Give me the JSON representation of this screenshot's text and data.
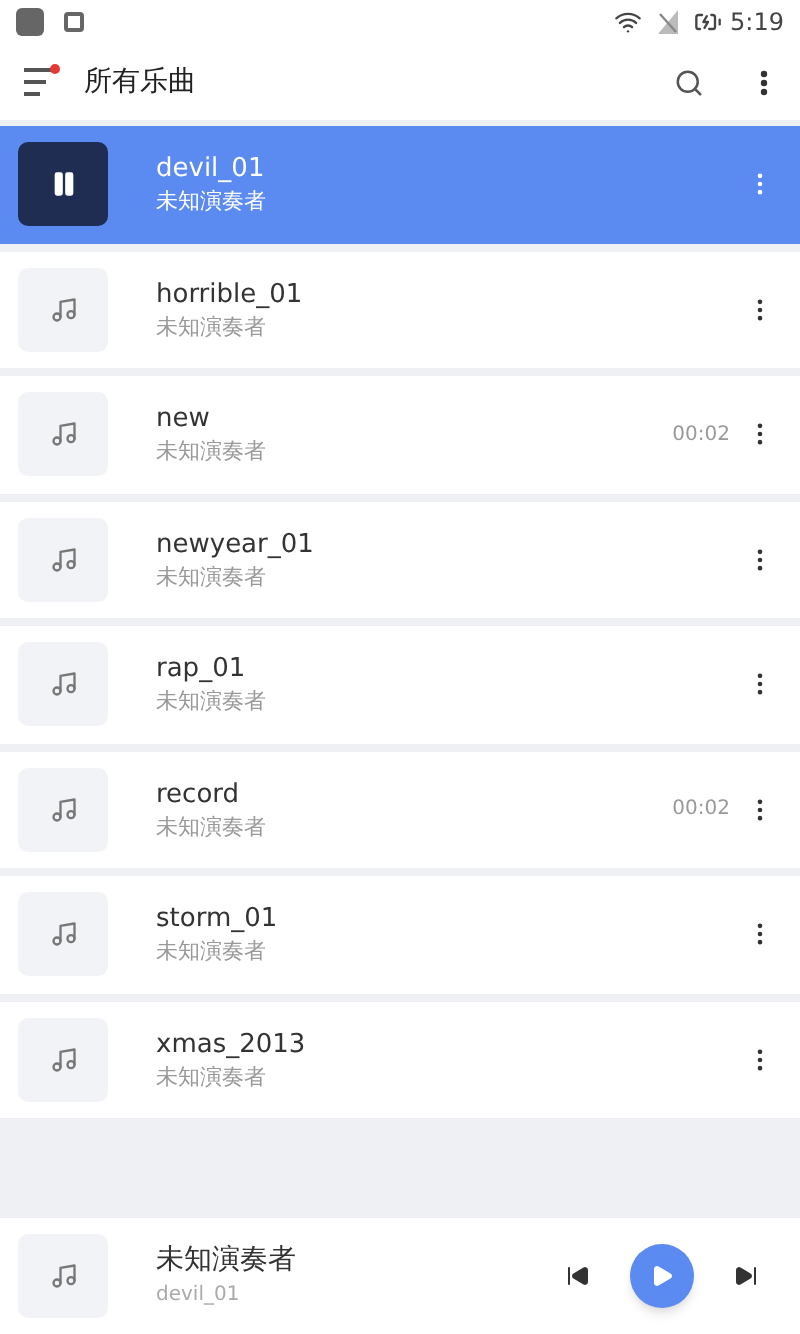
{
  "status_bar": {
    "time": "5:19"
  },
  "toolbar": {
    "title": "所有乐曲",
    "menu_badge": true
  },
  "songs": [
    {
      "title": "devil_01",
      "artist": "未知演奏者",
      "selected": true
    },
    {
      "title": "horrible_01",
      "artist": "未知演奏者",
      "selected": false
    },
    {
      "title": "new",
      "artist": "未知演奏者",
      "duration": "00:02",
      "selected": false
    },
    {
      "title": "newyear_01",
      "artist": "未知演奏者",
      "selected": false
    },
    {
      "title": "rap_01",
      "artist": "未知演奏者",
      "selected": false
    },
    {
      "title": "record",
      "artist": "未知演奏者",
      "duration": "00:02",
      "selected": false
    },
    {
      "title": "storm_01",
      "artist": "未知演奏者",
      "selected": false
    },
    {
      "title": "xmas_2013",
      "artist": "未知演奏者",
      "selected": false
    }
  ],
  "player": {
    "title": "未知演奏者",
    "subtitle": "devil_01",
    "playing": false
  }
}
